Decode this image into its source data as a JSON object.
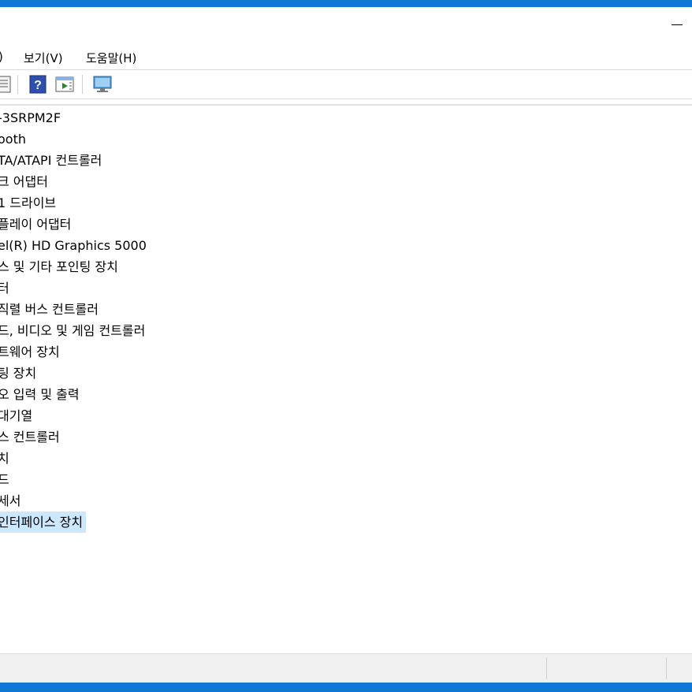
{
  "menu": {
    "partial": ")",
    "view": "보기(V)",
    "help": "도움말(H)"
  },
  "toolbar": {
    "icons": [
      "properties-icon",
      "help-icon",
      "run-icon",
      "monitor-icon"
    ]
  },
  "tree": {
    "items": [
      "-3SRPM2F",
      "ooth",
      "TA/ATAPI 컨트롤러",
      "크 어댑터",
      "1 드라이브",
      "플레이 어댑터",
      "el(R) HD Graphics 5000",
      "스 및 기타 포인팅 장치",
      "터",
      "직렬 버스 컨트롤러",
      "드, 비디오 및 게임 컨트롤러",
      "트웨어 장치",
      "팅 장치",
      "오 입력 및 출력",
      "대기열",
      "스 컨트롤러",
      "치",
      "드",
      "세서",
      "인터페이스 장치"
    ],
    "selected_index": 19
  },
  "colors": {
    "accent": "#0f78d7",
    "selection": "#cce8ff"
  }
}
